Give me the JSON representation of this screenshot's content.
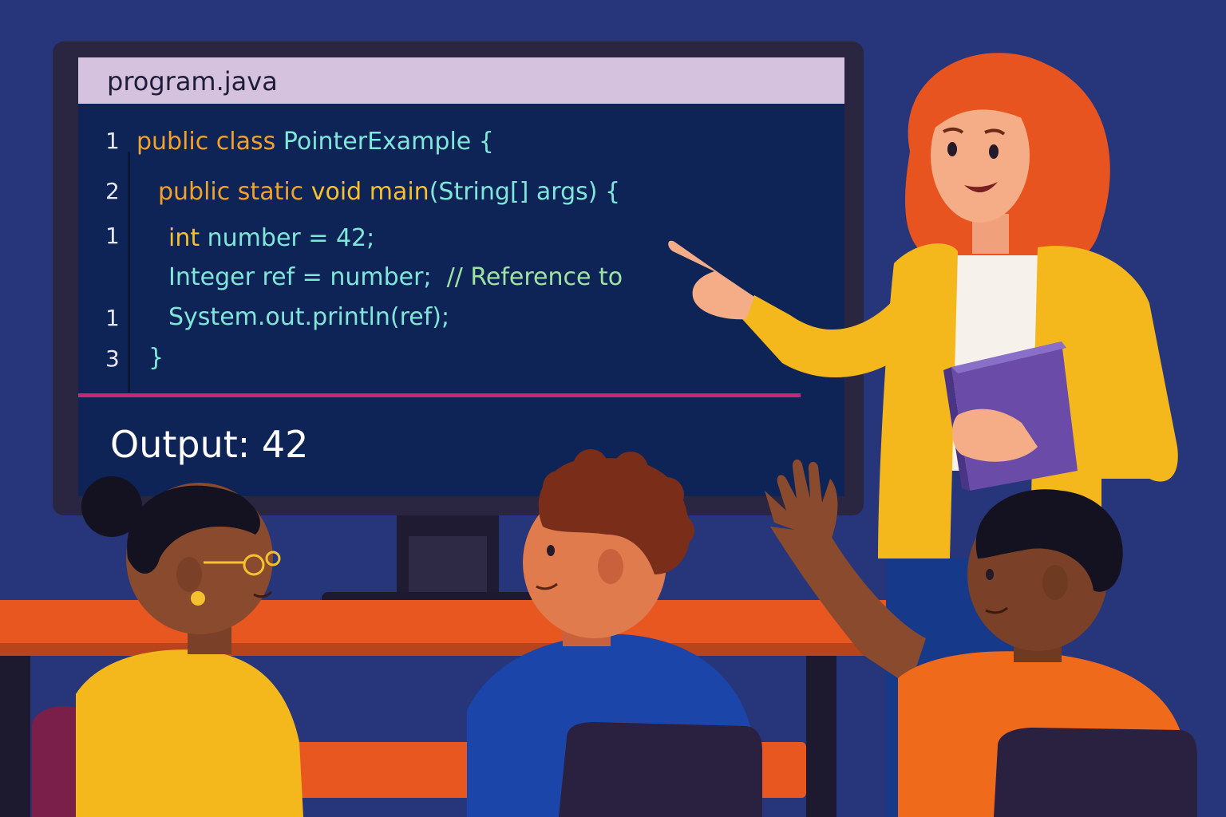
{
  "editor": {
    "filename": "program.java",
    "lines": [
      {
        "number": "1",
        "segments": [
          {
            "text": "public class ",
            "tone": "kw"
          },
          {
            "text": "PointerExample {",
            "tone": "ty"
          }
        ]
      },
      {
        "number": "2",
        "segments": [
          {
            "text": "public static ",
            "tone": "kw"
          },
          {
            "text": "void main",
            "tone": "kw-y"
          },
          {
            "text": "(String[] args) {",
            "tone": "ty"
          }
        ]
      },
      {
        "number": "1",
        "segments": [
          {
            "text": "int ",
            "tone": "kw-y"
          },
          {
            "text": "number = 42;",
            "tone": "ty"
          }
        ]
      },
      {
        "number": "",
        "segments": [
          {
            "text": "Integer ref = number;",
            "tone": "ty"
          },
          {
            "text": "  // Reference to",
            "tone": "cm"
          }
        ]
      },
      {
        "number": "1",
        "segments": [
          {
            "text": "System.out.println(ref);",
            "tone": "ty"
          }
        ]
      },
      {
        "number": "3",
        "segments": [
          {
            "text": "}",
            "tone": "ty"
          }
        ]
      }
    ]
  },
  "output": {
    "label": "Output: 42"
  },
  "colors": {
    "background": "#27357a",
    "screen": "#0f2456",
    "titlebar": "#d4c2de",
    "keyword_orange": "#f2a12a",
    "keyword_yellow": "#f5c12e",
    "code_teal": "#7fe7da",
    "comment_green": "#9fe3a3",
    "divider_pink": "#c4287a",
    "desk": "#e8571f",
    "teacher_hair": "#e8541f",
    "teacher_cardigan": "#f5b81c",
    "book": "#6a4ba8"
  },
  "illustration": {
    "teacher": "teacher-pointing-icon",
    "student_left": "student-with-glasses-icon",
    "student_middle": "student-curly-hair-icon",
    "student_right": "student-raising-hand-icon"
  }
}
